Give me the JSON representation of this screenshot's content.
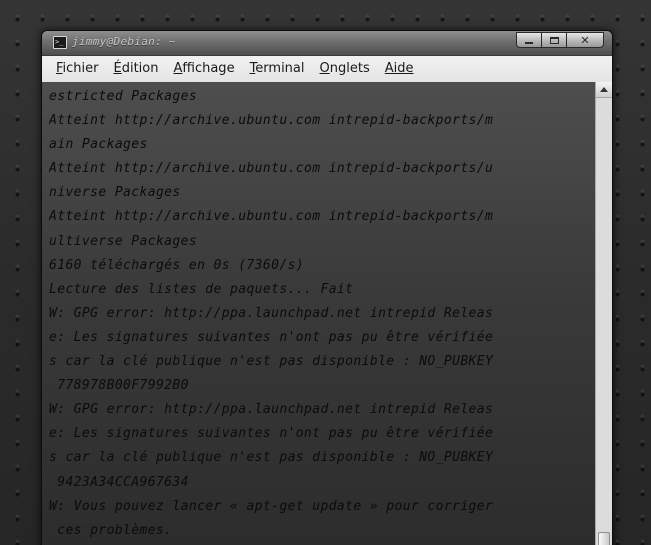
{
  "window": {
    "title": "jimmy@Debian: ~"
  },
  "menubar": {
    "items": [
      {
        "mnemonic": "F",
        "rest": "ichier"
      },
      {
        "mnemonic": "É",
        "rest": "dition"
      },
      {
        "mnemonic": "A",
        "rest": "ffichage"
      },
      {
        "mnemonic": "T",
        "rest": "erminal"
      },
      {
        "mnemonic": "O",
        "rest": "nglets"
      },
      {
        "mnemonic": "Aide",
        "rest": ""
      }
    ]
  },
  "terminal": {
    "lines": [
      "estricted Packages",
      "Atteint http://archive.ubuntu.com intrepid-backports/m",
      "ain Packages",
      "Atteint http://archive.ubuntu.com intrepid-backports/u",
      "niverse Packages",
      "Atteint http://archive.ubuntu.com intrepid-backports/m",
      "ultiverse Packages",
      "6160 téléchargés en 0s (7360/s)",
      "Lecture des listes de paquets... Fait",
      "W: GPG error: http://ppa.launchpad.net intrepid Releas",
      "e: Les signatures suivantes n'ont pas pu être vérifiée",
      "s car la clé publique n'est pas disponible : NO_PUBKEY",
      " 778978B00F7992B0",
      "W: GPG error: http://ppa.launchpad.net intrepid Releas",
      "e: Les signatures suivantes n'ont pas pu être vérifiée",
      "s car la clé publique n'est pas disponible : NO_PUBKEY",
      " 9423A34CCA967634",
      "W: Vous pouvez lancer « apt-get update » pour corriger",
      " ces problèmes."
    ]
  },
  "icons": {
    "title": "terminal-icon",
    "minimize": "minimize-icon",
    "maximize": "maximize-icon",
    "close": "close-icon",
    "scroll_up": "arrow-up-icon"
  },
  "scrollbar": {
    "position_fraction": 1.0
  }
}
